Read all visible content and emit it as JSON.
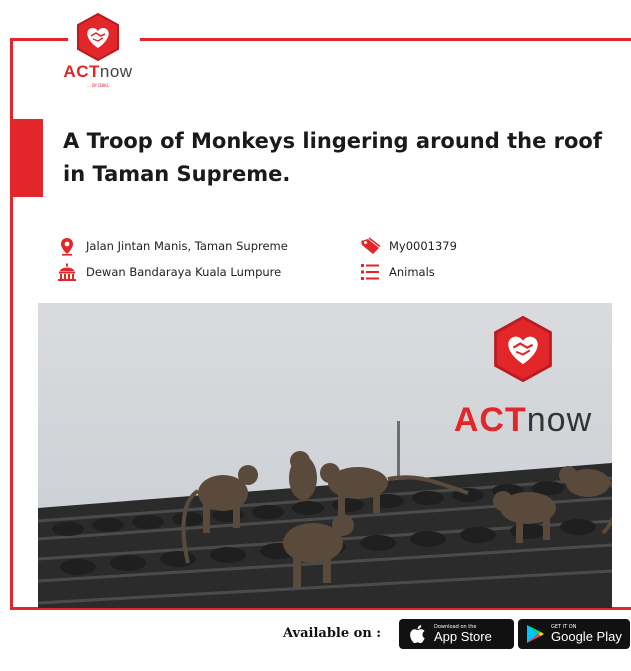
{
  "brand": {
    "act": "ACT",
    "now": "now",
    "tagline": "... BY DBKL",
    "colors": {
      "accent": "#e2262a",
      "dark": "#333333"
    }
  },
  "post": {
    "title": "A Troop of Monkeys lingering around the roof in Taman Supreme.",
    "location": "Jalan Jintan Manis, Taman Supreme",
    "authority": "Dewan Bandaraya Kuala Lumpure",
    "ticket_id": "My0001379",
    "category": "Animals"
  },
  "icons": {
    "location": "location-pin-icon",
    "authority": "building-icon",
    "ticket": "tag-icon",
    "category": "list-icon"
  },
  "footer": {
    "available_label": "Available on :",
    "app_store_small": "Download on the",
    "app_store_big": "App Store",
    "google_play_small": "GET IT ON",
    "google_play_big": "Google Play"
  }
}
